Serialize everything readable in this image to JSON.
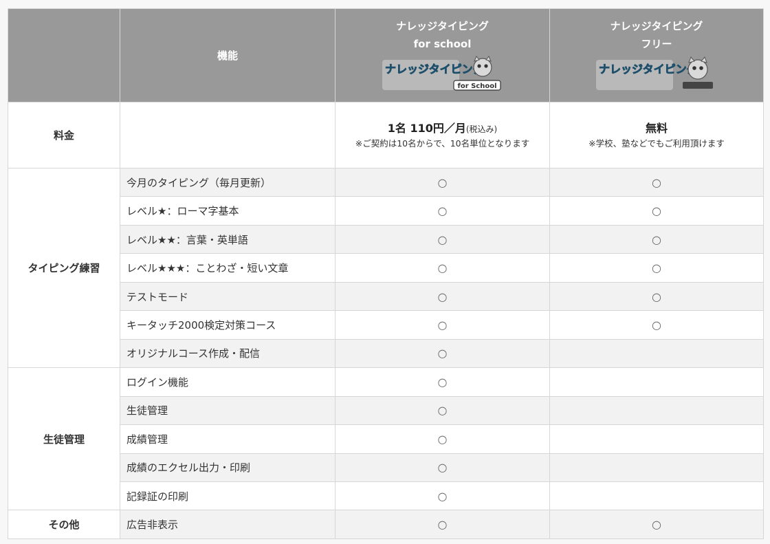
{
  "header": {
    "feature_col": "機能",
    "school_title_1": "ナレッジタイピング",
    "school_title_2": "for school",
    "free_title_1": "ナレッジタイピング",
    "free_title_2": "フリー",
    "school_logo_text": "ナレッジタイピング",
    "school_logo_badge": "for School",
    "free_logo_text": "ナレッジタイピング"
  },
  "price": {
    "label": "料金",
    "school_main": "1名 110円／月",
    "school_tax": "(税込み)",
    "school_note": "※ご契約は10名からで、10名単位となります",
    "free_main": "無料",
    "free_note": "※学校、塾などでもご利用頂けます"
  },
  "categories": {
    "typing": "タイピング練習",
    "students": "生徒管理",
    "other": "その他"
  },
  "rows": [
    {
      "feature": "今月のタイピング（毎月更新）",
      "school": "○",
      "free": "○"
    },
    {
      "feature": "レベル★：ローマ字基本",
      "school": "○",
      "free": "○"
    },
    {
      "feature": "レベル★★：言葉・英単語",
      "school": "○",
      "free": "○"
    },
    {
      "feature": "レベル★★★：ことわざ・短い文章",
      "school": "○",
      "free": "○"
    },
    {
      "feature": "テストモード",
      "school": "○",
      "free": "○"
    },
    {
      "feature": "キータッチ2000検定対策コース",
      "school": "○",
      "free": "○"
    },
    {
      "feature": "オリジナルコース作成・配信",
      "school": "○",
      "free": ""
    },
    {
      "feature": "ログイン機能",
      "school": "○",
      "free": ""
    },
    {
      "feature": "生徒管理",
      "school": "○",
      "free": ""
    },
    {
      "feature": "成績管理",
      "school": "○",
      "free": ""
    },
    {
      "feature": "成績のエクセル出力・印刷",
      "school": "○",
      "free": ""
    },
    {
      "feature": "記録証の印刷",
      "school": "○",
      "free": ""
    },
    {
      "feature": "広告非表示",
      "school": "○",
      "free": "○"
    }
  ],
  "colors": {
    "header_bg": "#999999",
    "alt_row": "#f2f2f2",
    "border": "#d6d6d6"
  }
}
